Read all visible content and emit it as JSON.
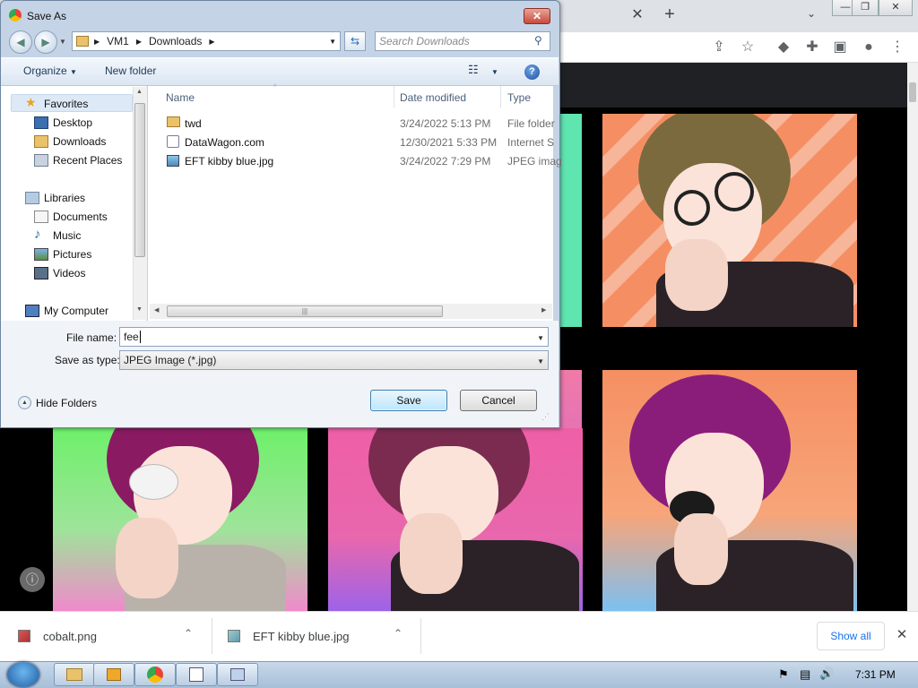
{
  "browser": {
    "tab_close": "✕",
    "new_tab": "+",
    "win_min": "—",
    "win_max": "❐",
    "win_close": "✕",
    "toolbar_icons": [
      "share-icon",
      "star-icon",
      "extension-icon",
      "puzzle-icon",
      "sidepanel-icon",
      "profile-icon",
      "menu-icon"
    ]
  },
  "dialog": {
    "title": "Save As",
    "close": "✕",
    "breadcrumb": [
      "VM1",
      "Downloads"
    ],
    "search_placeholder": "Search Downloads",
    "organize": "Organize",
    "new_folder": "New folder",
    "nav": {
      "favorites": "Favorites",
      "desktop": "Desktop",
      "downloads": "Downloads",
      "recent": "Recent Places",
      "libraries": "Libraries",
      "documents": "Documents",
      "music": "Music",
      "pictures": "Pictures",
      "videos": "Videos",
      "computer": "My Computer"
    },
    "columns": {
      "name": "Name",
      "date": "Date modified",
      "type": "Type"
    },
    "files": [
      {
        "name": "twd",
        "date": "3/24/2022 5:13 PM",
        "type": "File folder"
      },
      {
        "name": "DataWagon.com",
        "date": "12/30/2021 5:33 PM",
        "type": "Internet S"
      },
      {
        "name": "EFT kibby blue.jpg",
        "date": "3/24/2022 7:29 PM",
        "type": "JPEG imag"
      }
    ],
    "file_name_label": "File name:",
    "file_name_value": "fee",
    "save_type_label": "Save as type:",
    "save_type_value": "JPEG Image (*.jpg)",
    "hide_folders": "Hide Folders",
    "save": "Save",
    "cancel": "Cancel"
  },
  "downloads": [
    {
      "name": "cobalt.png"
    },
    {
      "name": "EFT kibby blue.jpg"
    }
  ],
  "show_all": "Show all",
  "close_bar": "✕",
  "taskbar": {
    "time": "7:31 PM"
  },
  "colors": {
    "accent": "#1a73e8",
    "dialog_frame": "#c4d4e6"
  }
}
